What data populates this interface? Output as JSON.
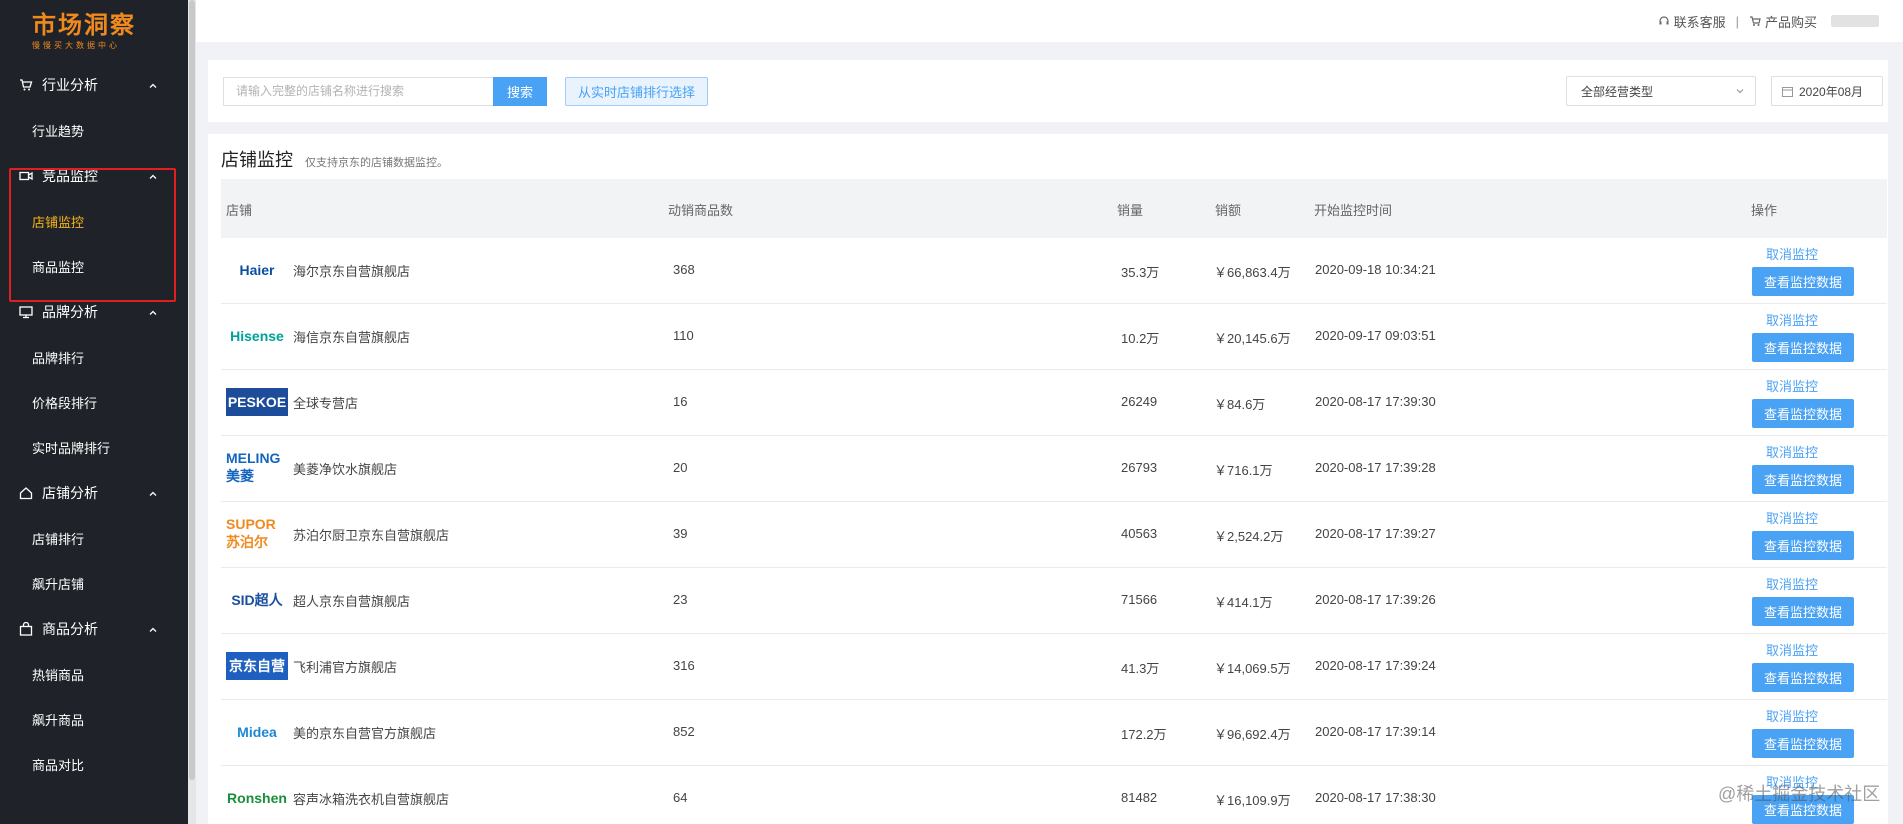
{
  "app": {
    "logo_title": "市场洞察",
    "logo_sub": "慢慢买大数据中心"
  },
  "topbar": {
    "support_label": "联系客服",
    "separator": "|",
    "buy_label": "产品购买"
  },
  "sidebar": {
    "groups": [
      {
        "label": "行业分析",
        "icon": "shopping-cart-icon",
        "items": [
          {
            "label": "行业趋势",
            "active": false
          }
        ]
      },
      {
        "label": "竞品监控",
        "icon": "video-camera-icon",
        "items": [
          {
            "label": "店铺监控",
            "active": true
          },
          {
            "label": "商品监控",
            "active": false
          }
        ]
      },
      {
        "label": "品牌分析",
        "icon": "monitor-icon",
        "items": [
          {
            "label": "品牌排行",
            "active": false
          },
          {
            "label": "价格段排行",
            "active": false
          },
          {
            "label": "实时品牌排行",
            "active": false
          }
        ]
      },
      {
        "label": "店铺分析",
        "icon": "home-icon",
        "items": [
          {
            "label": "店铺排行",
            "active": false
          },
          {
            "label": "飙升店铺",
            "active": false
          }
        ]
      },
      {
        "label": "商品分析",
        "icon": "shopping-bag-icon",
        "items": [
          {
            "label": "热销商品",
            "active": false
          },
          {
            "label": "飙升商品",
            "active": false
          },
          {
            "label": "商品对比",
            "active": false
          }
        ]
      }
    ]
  },
  "search": {
    "placeholder": "请输入完整的店铺名称进行搜索",
    "search_button": "搜索",
    "rank_select_button": "从实时店铺排行选择",
    "type_select": "全部经营类型",
    "date": "2020年08月"
  },
  "section": {
    "title": "店铺监控",
    "subtitle": "仅支持京东的店铺数据监控。"
  },
  "table": {
    "columns": [
      "店铺",
      "动销商品数",
      "销量",
      "销额",
      "开始监控时间",
      "操作"
    ],
    "cancel_label": "取消监控",
    "view_label": "查看监控数据",
    "rows": [
      {
        "logo_text": "Haier",
        "logo_color": "#0a4ea1",
        "logo_bg": "#ffffff",
        "shop": "海尔京东自营旗舰店",
        "skus": "368",
        "sales": "35.3万",
        "revenue": "￥66,863.4万",
        "start": "2020-09-18 10:34:21"
      },
      {
        "logo_text": "Hisense",
        "logo_color": "#00a19a",
        "logo_bg": "#ffffff",
        "shop": "海信京东自营旗舰店",
        "skus": "110",
        "sales": "10.2万",
        "revenue": "￥20,145.6万",
        "start": "2020-09-17 09:03:51"
      },
      {
        "logo_text": "PESKOE",
        "logo_color": "#ffffff",
        "logo_bg": "#1d4d9a",
        "shop": "全球专营店",
        "skus": "16",
        "sales": "26249",
        "revenue": "￥84.6万",
        "start": "2020-08-17 17:39:30"
      },
      {
        "logo_text": "MELING美菱",
        "logo_color": "#1565c0",
        "logo_bg": "#ffffff",
        "shop": "美菱净饮水旗舰店",
        "skus": "20",
        "sales": "26793",
        "revenue": "￥716.1万",
        "start": "2020-08-17 17:39:28"
      },
      {
        "logo_text": "SUPOR苏泊尔",
        "logo_color": "#f08a1e",
        "logo_bg": "#ffffff",
        "shop": "苏泊尔厨卫京东自营旗舰店",
        "skus": "39",
        "sales": "40563",
        "revenue": "￥2,524.2万",
        "start": "2020-08-17 17:39:27"
      },
      {
        "logo_text": "SID超人",
        "logo_color": "#1a4fa0",
        "logo_bg": "#ffffff",
        "shop": "超人京东自营旗舰店",
        "skus": "23",
        "sales": "71566",
        "revenue": "￥414.1万",
        "start": "2020-08-17 17:39:26"
      },
      {
        "logo_text": "京东自营",
        "logo_color": "#ffffff",
        "logo_bg": "#1f5fbf",
        "shop": "飞利浦官方旗舰店",
        "skus": "316",
        "sales": "41.3万",
        "revenue": "￥14,069.5万",
        "start": "2020-08-17 17:39:24"
      },
      {
        "logo_text": "Midea",
        "logo_color": "#1e88d4",
        "logo_bg": "#ffffff",
        "shop": "美的京东自营官方旗舰店",
        "skus": "852",
        "sales": "172.2万",
        "revenue": "￥96,692.4万",
        "start": "2020-08-17 17:39:14"
      },
      {
        "logo_text": "Ronshen",
        "logo_color": "#1a8f3a",
        "logo_bg": "#ffffff",
        "shop": "容声冰箱洗衣机自营旗舰店",
        "skus": "64",
        "sales": "81482",
        "revenue": "￥16,109.9万",
        "start": "2020-08-17 17:38:30"
      }
    ]
  },
  "watermark": "@稀土掘金技术社区"
}
